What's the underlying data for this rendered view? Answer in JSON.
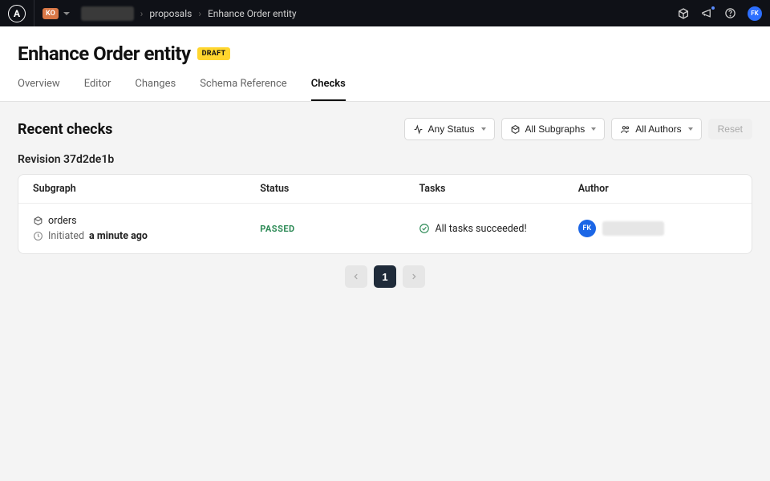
{
  "brand_letter": "A",
  "org_badge": "KO",
  "breadcrumb": {
    "graph": "■■■■■■■■",
    "proposals": "proposals",
    "current": "Enhance Order entity"
  },
  "avatar_initials": "FK",
  "page": {
    "title": "Enhance Order entity",
    "badge": "DRAFT"
  },
  "tabs": {
    "overview": "Overview",
    "editor": "Editor",
    "changes": "Changes",
    "schema_ref": "Schema Reference",
    "checks": "Checks"
  },
  "section_title": "Recent checks",
  "filters": {
    "status": "Any Status",
    "subgraphs": "All Subgraphs",
    "authors": "All Authors",
    "reset": "Reset"
  },
  "revision_label": "Revision 37d2de1b",
  "table": {
    "headers": {
      "subgraph": "Subgraph",
      "status": "Status",
      "tasks": "Tasks",
      "author": "Author"
    },
    "rows": [
      {
        "subgraph": "orders",
        "initiated_prefix": "Initiated ",
        "initiated_time": "a minute ago",
        "status": "PASSED",
        "tasks": "All tasks succeeded!",
        "author_initials": "FK",
        "author_name": "■■■■■■■■■"
      }
    ]
  },
  "pagination": {
    "current": "1"
  }
}
